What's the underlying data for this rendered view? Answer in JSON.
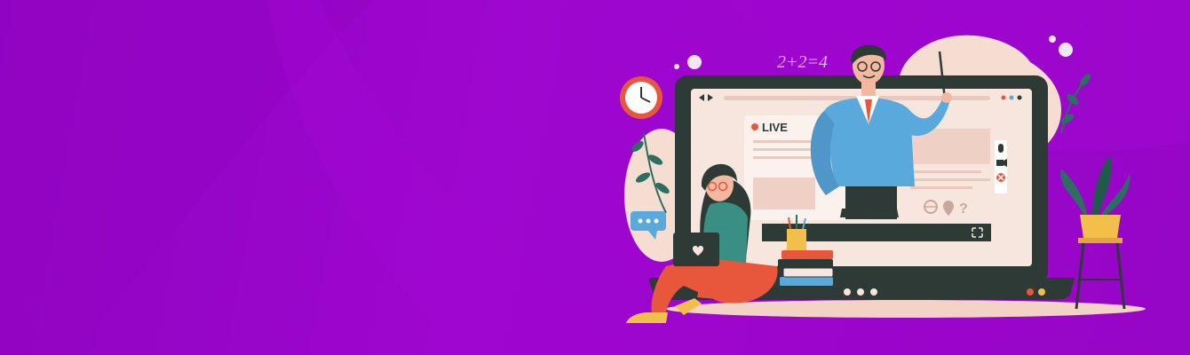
{
  "banner": {
    "equation": "2+2=4",
    "live_label": "LIVE"
  },
  "colors": {
    "background": "#9a06c8",
    "laptop": "#2e3a36",
    "screen": "#f6e6de",
    "teacher_jacket": "#5aa9dc",
    "student_pants": "#e8573c",
    "live_dot": "#e8573c",
    "plant": "#2c6e5f",
    "pot": "#f2c04a"
  },
  "icons": [
    "clock-icon",
    "chat-bubble-icon",
    "globe-icon",
    "location-pin-icon",
    "question-icon",
    "microphone-icon",
    "camera-icon",
    "close-icon",
    "fullscreen-icon",
    "pencil-cup-icon",
    "books-icon",
    "plant-icon",
    "leaf-icon"
  ]
}
